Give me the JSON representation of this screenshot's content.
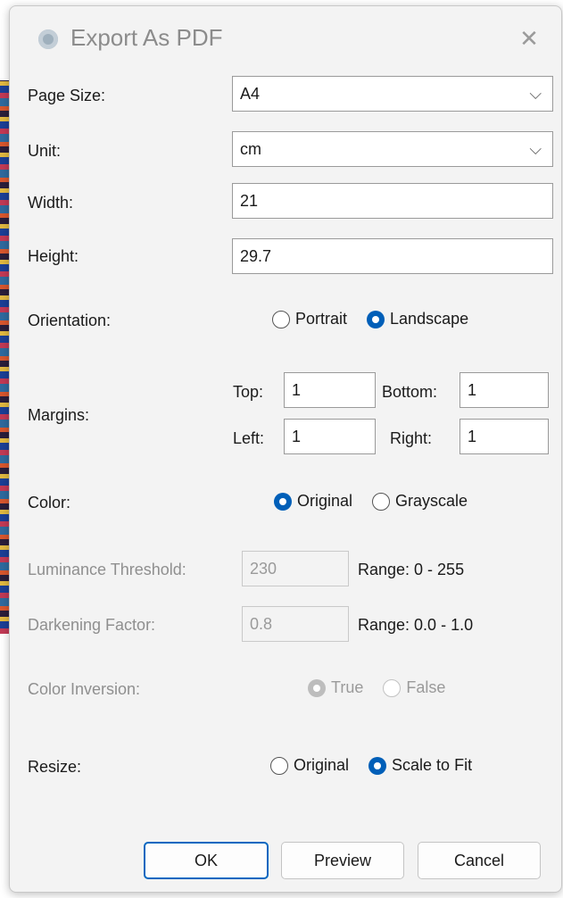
{
  "dialog": {
    "title": "Export As PDF",
    "close_glyph": "✕"
  },
  "page_size": {
    "label": "Page Size:",
    "value": "A4"
  },
  "unit": {
    "label": "Unit:",
    "value": "cm"
  },
  "width": {
    "label": "Width:",
    "value": "21"
  },
  "height": {
    "label": "Height:",
    "value": "29.7"
  },
  "orientation": {
    "label": "Orientation:",
    "options": [
      "Portrait",
      "Landscape"
    ],
    "selected": "Landscape"
  },
  "margins": {
    "label": "Margins:",
    "top_label": "Top:",
    "top": "1",
    "bottom_label": "Bottom:",
    "bottom": "1",
    "left_label": "Left:",
    "left": "1",
    "right_label": "Right:",
    "right": "1"
  },
  "color": {
    "label": "Color:",
    "options": [
      "Original",
      "Grayscale"
    ],
    "selected": "Original"
  },
  "luminance": {
    "label": "Luminance Threshold:",
    "value": "230",
    "range": "Range: 0 - 255"
  },
  "darkening": {
    "label": "Darkening Factor:",
    "value": "0.8",
    "range": "Range: 0.0 - 1.0"
  },
  "inversion": {
    "label": "Color Inversion:",
    "options": [
      "True",
      "False"
    ],
    "selected": "True"
  },
  "resize": {
    "label": "Resize:",
    "options": [
      "Original",
      "Scale to Fit"
    ],
    "selected": "Scale to Fit"
  },
  "buttons": {
    "ok": "OK",
    "preview": "Preview",
    "cancel": "Cancel"
  },
  "colors": {
    "accent": "#005fb8",
    "dialog_bg": "#f3f3f3"
  }
}
